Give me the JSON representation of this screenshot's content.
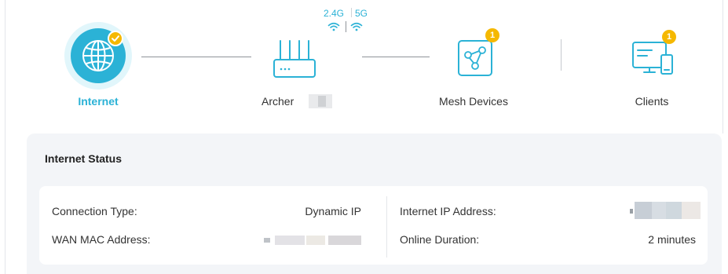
{
  "topology": {
    "internet": {
      "label": "Internet",
      "icon": "globe-icon",
      "status_icon": "check-badge-icon"
    },
    "router": {
      "label": "Archer",
      "icon": "router-icon",
      "bands": [
        "2.4G",
        "5G"
      ],
      "band_icons": [
        "wifi-24g-icon",
        "wifi-5g-icon"
      ]
    },
    "mesh": {
      "label": "Mesh Devices",
      "icon": "mesh-icon",
      "count": "1"
    },
    "clients": {
      "label": "Clients",
      "icon": "clients-icon",
      "count": "1"
    }
  },
  "internet_status": {
    "title": "Internet Status",
    "left_rows": [
      {
        "label": "Connection Type:",
        "value": "Dynamic IP"
      },
      {
        "label": "WAN MAC Address:",
        "value": ""
      }
    ],
    "right_rows": [
      {
        "label": "Internet IP Address:",
        "value": ""
      },
      {
        "label": "Online Duration:",
        "value": "2 minutes"
      }
    ]
  },
  "colors": {
    "accent": "#2bb2d6",
    "badge": "#f5b800",
    "panel_bg": "#f3f5f8"
  }
}
